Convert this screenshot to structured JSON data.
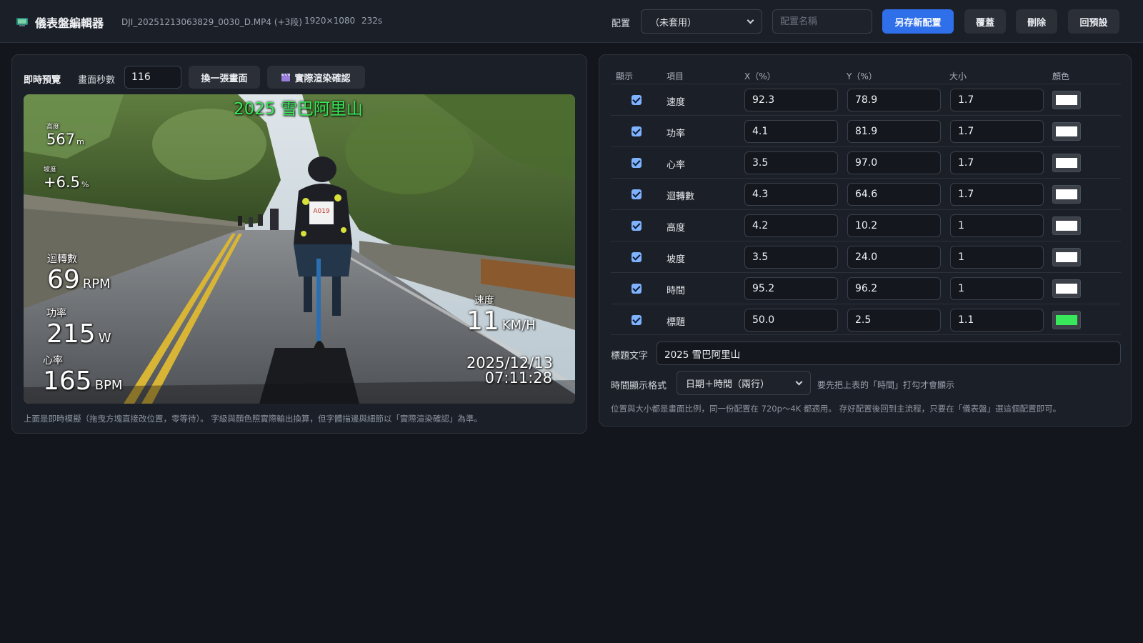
{
  "header": {
    "app_title": "儀表盤編輯器",
    "file_name": "DJI_20251213063829_0030_D.MP4 (+3段)",
    "resolution": "1920×1080",
    "duration": "232s",
    "config_label": "配置",
    "config_selected": "（未套用）",
    "config_name_placeholder": "配置名稱",
    "save_new_label": "另存新配置",
    "overwrite_label": "覆蓋",
    "delete_label": "刪除",
    "reset_label": "回預設",
    "icon": "monitor-icon",
    "accent_color": "#2f6fea"
  },
  "preview": {
    "title": "即時預覽",
    "seconds_label": "畫面秒數",
    "seconds_value": "116",
    "switch_frame_label": "換一張畫面",
    "render_check_label": "實際渲染確認",
    "render_check_icon": "clapperboard-icon",
    "note": "上面是即時模擬（拖曳方塊直接改位置，零等待）。 字級與顏色照實際輸出換算，但字體描邊與細節以「實際渲染確認」為準。",
    "overlay": {
      "title": "2025 雪巴阿里山",
      "title_color": "#39e85a",
      "altitude_label": "高度",
      "altitude_value": "567",
      "altitude_unit": "m",
      "grade_label": "坡度",
      "grade_value": "+6.5",
      "grade_unit": "%",
      "cadence_label": "迴轉數",
      "cadence_value": "69",
      "cadence_unit": "RPM",
      "power_label": "功率",
      "power_value": "215",
      "power_unit": "W",
      "hr_label": "心率",
      "hr_value": "165",
      "hr_unit": "BPM",
      "speed_label": "速度",
      "speed_value": "11",
      "speed_unit": "KM/H",
      "date": "2025/12/13",
      "time": "07:11:28",
      "bib_text": "A019"
    }
  },
  "table": {
    "headers": [
      "顯示",
      "項目",
      "X（%）",
      "Y（%）",
      "大小",
      "顏色"
    ],
    "rows": [
      {
        "name": "速度",
        "x": "92.3",
        "y": "78.9",
        "size": "1.7",
        "color": "#ffffff",
        "checked": true
      },
      {
        "name": "功率",
        "x": "4.1",
        "y": "81.9",
        "size": "1.7",
        "color": "#ffffff",
        "checked": true
      },
      {
        "name": "心率",
        "x": "3.5",
        "y": "97.0",
        "size": "1.7",
        "color": "#ffffff",
        "checked": true
      },
      {
        "name": "迴轉數",
        "x": "4.3",
        "y": "64.6",
        "size": "1.7",
        "color": "#ffffff",
        "checked": true
      },
      {
        "name": "高度",
        "x": "4.2",
        "y": "10.2",
        "size": "1",
        "color": "#ffffff",
        "checked": true
      },
      {
        "name": "坡度",
        "x": "3.5",
        "y": "24.0",
        "size": "1",
        "color": "#ffffff",
        "checked": true
      },
      {
        "name": "時間",
        "x": "95.2",
        "y": "96.2",
        "size": "1",
        "color": "#ffffff",
        "checked": true
      },
      {
        "name": "標題",
        "x": "50.0",
        "y": "2.5",
        "size": "1.1",
        "color": "#39e85a",
        "checked": true
      }
    ]
  },
  "settings": {
    "title_text_label": "標題文字",
    "title_text_value": "2025 雪巴阿里山",
    "time_format_label": "時間顯示格式",
    "time_format_value": "日期＋時間（兩行）",
    "time_format_hint": "要先把上表的「時間」打勾才會顯示",
    "note": "位置與大小都是畫面比例，同一份配置在 720p～4K 都適用。 存好配置後回到主流程，只要在「儀表盤」選這個配置即可。"
  }
}
